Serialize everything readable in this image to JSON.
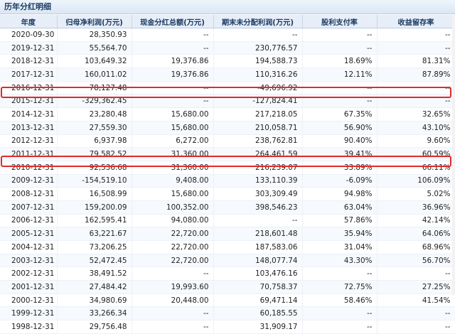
{
  "panel": {
    "title": "历年分红明细"
  },
  "columns": [
    "年度",
    "归母净利润(万元)",
    "现金分红总额(万元)",
    "期末未分配利润(万元)",
    "股利支付率",
    "收益留存率"
  ],
  "rows": [
    [
      "2020-09-30",
      "28,350.93",
      "--",
      "--",
      "--",
      "--"
    ],
    [
      "2019-12-31",
      "55,564.70",
      "--",
      "230,776.57",
      "--",
      "--"
    ],
    [
      "2018-12-31",
      "103,649.32",
      "19,376.86",
      "194,588.73",
      "18.69%",
      "81.31%"
    ],
    [
      "2017-12-31",
      "160,011.02",
      "19,376.86",
      "110,316.26",
      "12.11%",
      "87.89%"
    ],
    [
      "2016-12-31",
      "78,127.48",
      "--",
      "-49,696.92",
      "--",
      "--"
    ],
    [
      "2015-12-31",
      "-329,362.45",
      "--",
      "-127,824.41",
      "--",
      "--"
    ],
    [
      "2014-12-31",
      "23,280.48",
      "15,680.00",
      "217,218.05",
      "67.35%",
      "32.65%"
    ],
    [
      "2013-12-31",
      "27,559.30",
      "15,680.00",
      "210,058.71",
      "56.90%",
      "43.10%"
    ],
    [
      "2012-12-31",
      "6,937.98",
      "6,272.00",
      "238,762.81",
      "90.40%",
      "9.60%"
    ],
    [
      "2011-12-31",
      "79,582.52",
      "31,360.00",
      "264,461.59",
      "39.41%",
      "60.59%"
    ],
    [
      "2010-12-31",
      "92,536.68",
      "31,360.00",
      "216,239.07",
      "33.89%",
      "66.11%"
    ],
    [
      "2009-12-31",
      "-154,519.10",
      "9,408.00",
      "133,110.39",
      "-6.09%",
      "106.09%"
    ],
    [
      "2008-12-31",
      "16,508.99",
      "15,680.00",
      "303,309.49",
      "94.98%",
      "5.02%"
    ],
    [
      "2007-12-31",
      "159,200.09",
      "100,352.00",
      "398,546.23",
      "63.04%",
      "36.96%"
    ],
    [
      "2006-12-31",
      "162,595.41",
      "94,080.00",
      "--",
      "57.86%",
      "42.14%"
    ],
    [
      "2005-12-31",
      "63,221.67",
      "22,720.00",
      "218,601.48",
      "35.94%",
      "64.06%"
    ],
    [
      "2004-12-31",
      "73,206.25",
      "22,720.00",
      "187,583.06",
      "31.04%",
      "68.96%"
    ],
    [
      "2003-12-31",
      "52,472.45",
      "22,720.00",
      "148,077.74",
      "43.30%",
      "56.70%"
    ],
    [
      "2002-12-31",
      "38,491.52",
      "--",
      "103,476.16",
      "--",
      "--"
    ],
    [
      "2001-12-31",
      "27,484.42",
      "19,993.60",
      "70,758.37",
      "72.75%",
      "27.25%"
    ],
    [
      "2000-12-31",
      "34,980.69",
      "20,448.00",
      "69,471.14",
      "58.46%",
      "41.54%"
    ],
    [
      "1999-12-31",
      "33,266.34",
      "--",
      "60,185.55",
      "--",
      "--"
    ],
    [
      "1998-12-31",
      "29,756.48",
      "--",
      "31,909.17",
      "--",
      "--"
    ]
  ],
  "highlighted_rows": [
    "2015-12-31",
    "2009-12-31"
  ],
  "colors": {
    "highlight_border": "#e02a2a",
    "header_bg": "#e7eef7",
    "header_text": "#1b3a63"
  }
}
